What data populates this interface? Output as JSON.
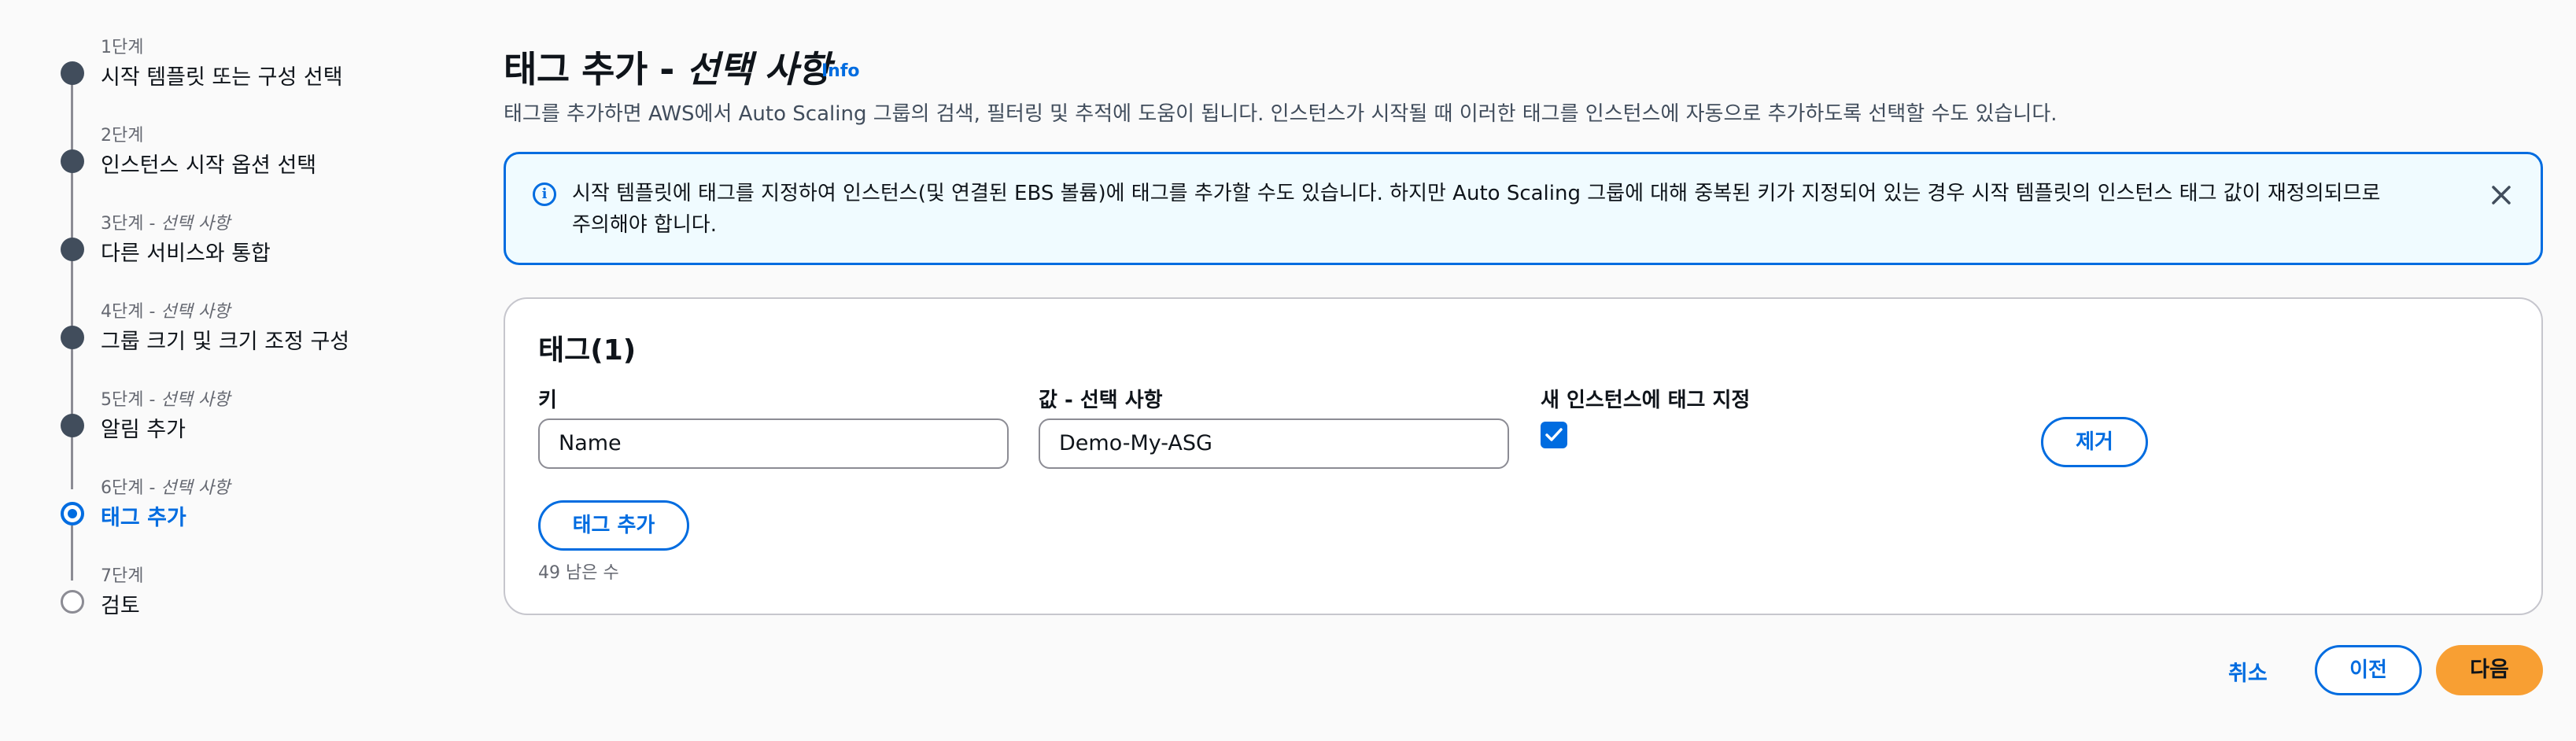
{
  "stepper": {
    "steps": [
      {
        "num": "1단계",
        "optional": "",
        "title": "시작 템플릿 또는 구성 선택"
      },
      {
        "num": "2단계",
        "optional": "",
        "title": "인스턴스 시작 옵션 선택"
      },
      {
        "num": "3단계 - ",
        "optional": "선택 사항",
        "title": "다른 서비스와 통합"
      },
      {
        "num": "4단계 - ",
        "optional": "선택 사항",
        "title": "그룹 크기 및 크기 조정 구성"
      },
      {
        "num": "5단계 - ",
        "optional": "선택 사항",
        "title": "알림 추가"
      },
      {
        "num": "6단계 - ",
        "optional": "선택 사항",
        "title": "태그 추가"
      },
      {
        "num": "7단계",
        "optional": "",
        "title": "검토"
      }
    ]
  },
  "header": {
    "title_main": "태그 추가 - ",
    "title_optional": "선택 사항",
    "info_label": "Info",
    "description": "태그를 추가하면 AWS에서 Auto Scaling 그룹의 검색, 필터링 및 추적에 도움이 됩니다. 인스턴스가 시작될 때 이러한 태그를 인스턴스에 자동으로 추가하도록 선택할 수도 있습니다."
  },
  "alert": {
    "icon": "info-icon",
    "text": "시작 템플릿에 태그를 지정하여 인스턴스(및 연결된 EBS 볼륨)에 태그를 추가할 수도 있습니다. 하지만 Auto Scaling 그룹에 대해 중복된 키가 지정되어 있는 경우 시작 템플릿의 인스턴스 태그 값이 재정의되므로 주의해야 합니다.",
    "close_icon": "close-icon"
  },
  "tags_panel": {
    "title": "태그(1)",
    "key_label": "키",
    "value_label": "값 - 선택 사항",
    "tag_new_instances_label": "새 인스턴스에 태그 지정",
    "rows": [
      {
        "key": "Name",
        "value": "Demo-My-ASG",
        "tag_new_instances": true,
        "remove_label": "제거"
      }
    ],
    "add_tag_label": "태그 추가",
    "remaining_text": "49 남은 수"
  },
  "footer": {
    "cancel_label": "취소",
    "previous_label": "이전",
    "next_label": "다음"
  },
  "colors": {
    "accent": "#006ce0",
    "primary_button": "#f89f33",
    "alert_bg": "#f0fbff",
    "step_complete": "#414d5c"
  }
}
